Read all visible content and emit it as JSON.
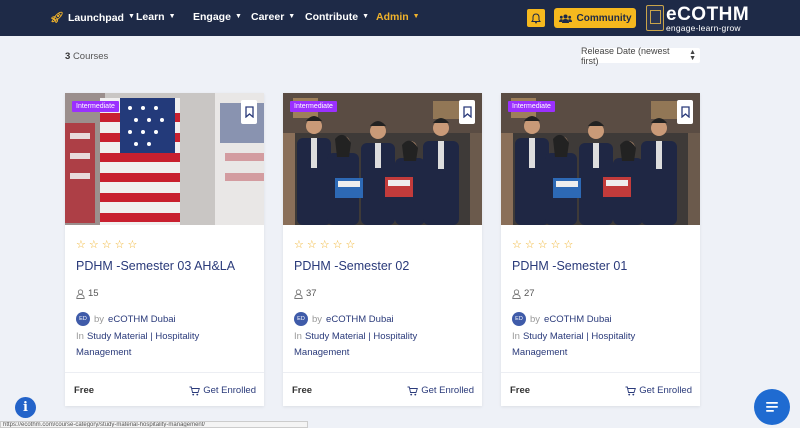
{
  "nav": {
    "items": [
      {
        "label": "Launchpad"
      },
      {
        "label": "Learn"
      },
      {
        "label": "Engage"
      },
      {
        "label": "Career"
      },
      {
        "label": "Contribute"
      },
      {
        "label": "Admin"
      }
    ],
    "community_label": "Community",
    "brand_name": "eCOTHM",
    "brand_tagline": "engage-learn-grow"
  },
  "colors": {
    "nav_bg": "#1e2a47",
    "accent": "#f5b81e",
    "badge": "#9b30ff",
    "link": "#2a3a7a"
  },
  "toolbar": {
    "count": "3",
    "count_label": "Courses",
    "sort_value": "Release Date (newest first)"
  },
  "courses": [
    {
      "level": "Intermediate",
      "title": "PDHM -Semester 03 AH&LA",
      "students": "15",
      "by": "by",
      "author_initials": "ED",
      "author": "eCOTHM Dubai",
      "in": "In",
      "category": "Study Material | Hospitality Management",
      "price": "Free",
      "cta": "Get Enrolled",
      "image": "flags"
    },
    {
      "level": "Intermediate",
      "title": "PDHM -Semester 02",
      "students": "37",
      "by": "by",
      "author_initials": "ED",
      "author": "eCOTHM Dubai",
      "in": "In",
      "category": "Study Material | Hospitality Management",
      "price": "Free",
      "cta": "Get Enrolled",
      "image": "group-photo"
    },
    {
      "level": "Intermediate",
      "title": "PDHM -Semester 01",
      "students": "27",
      "by": "by",
      "author_initials": "ED",
      "author": "eCOTHM Dubai",
      "in": "In",
      "category": "Study Material | Hospitality Management",
      "price": "Free",
      "cta": "Get Enrolled",
      "image": "group-photo"
    }
  ],
  "status_bar_url": "https://ecothm.com/course-category/study-material-hospitality-management/"
}
